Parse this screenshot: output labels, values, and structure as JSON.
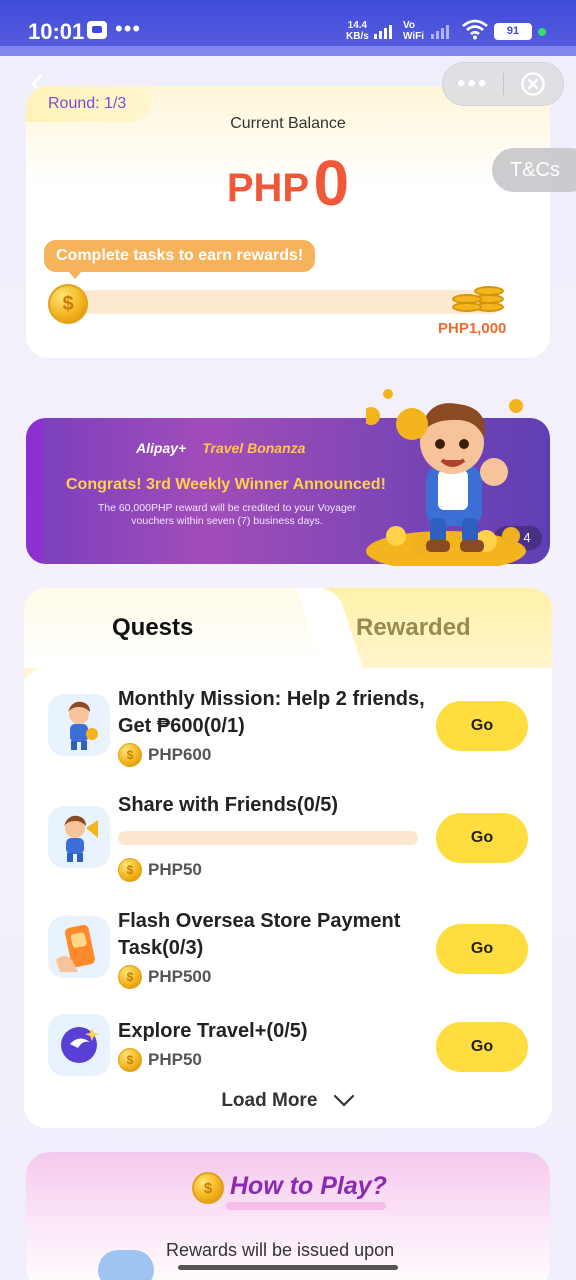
{
  "status_bar": {
    "time": "10:01",
    "dots": "•••",
    "speed_value": "14.4",
    "speed_unit": "KB/s",
    "vo": "Vo",
    "wifi_label": "WiFi",
    "battery": "91"
  },
  "capsule": {
    "more_label": "•••"
  },
  "balance": {
    "round": "Round: 1/3",
    "label": "Current Balance",
    "currency": "PHP",
    "amount": "0",
    "hint": "Complete tasks to earn rewards!",
    "goal": "PHP1,000",
    "coin_symbol": "$",
    "progress": 0
  },
  "tc_label": "T&Cs",
  "banner": {
    "brand": "Alipay+",
    "campaign": "Travel Bonanza",
    "title": "Congrats! 3rd Weekly Winner Announced!",
    "description": "The 60,000PHP reward will be credited to your Voyager vouchers within seven (7) business days.",
    "pager": "2 / 4"
  },
  "tabs": {
    "active": "Quests",
    "inactive": "Rewarded"
  },
  "tasks": [
    {
      "title": "Monthly Mission: Help 2 friends, Get ₱600(0/1)",
      "reward": "PHP600",
      "button": "Go"
    },
    {
      "title": "Share with Friends(0/5)",
      "reward": "PHP50",
      "button": "Go"
    },
    {
      "title": "Flash Oversea Store Payment Task(0/3)",
      "reward": "PHP500",
      "button": "Go"
    },
    {
      "title": "Explore Travel+(0/5)",
      "reward": "PHP50",
      "button": "Go"
    }
  ],
  "load_more": "Load More",
  "how_to_play": {
    "title": "How to Play?",
    "first_step": "Rewards will be issued upon"
  },
  "colors": {
    "accent_red": "#f0583a",
    "go_yellow": "#ffdd3f",
    "banner_purple": "#7a3fbe",
    "title_purple": "#8b2ab0"
  },
  "icons": [
    "close-icon",
    "back-arrow-icon",
    "coin-icon",
    "chevron-down-icon",
    "wifi-icon"
  ]
}
